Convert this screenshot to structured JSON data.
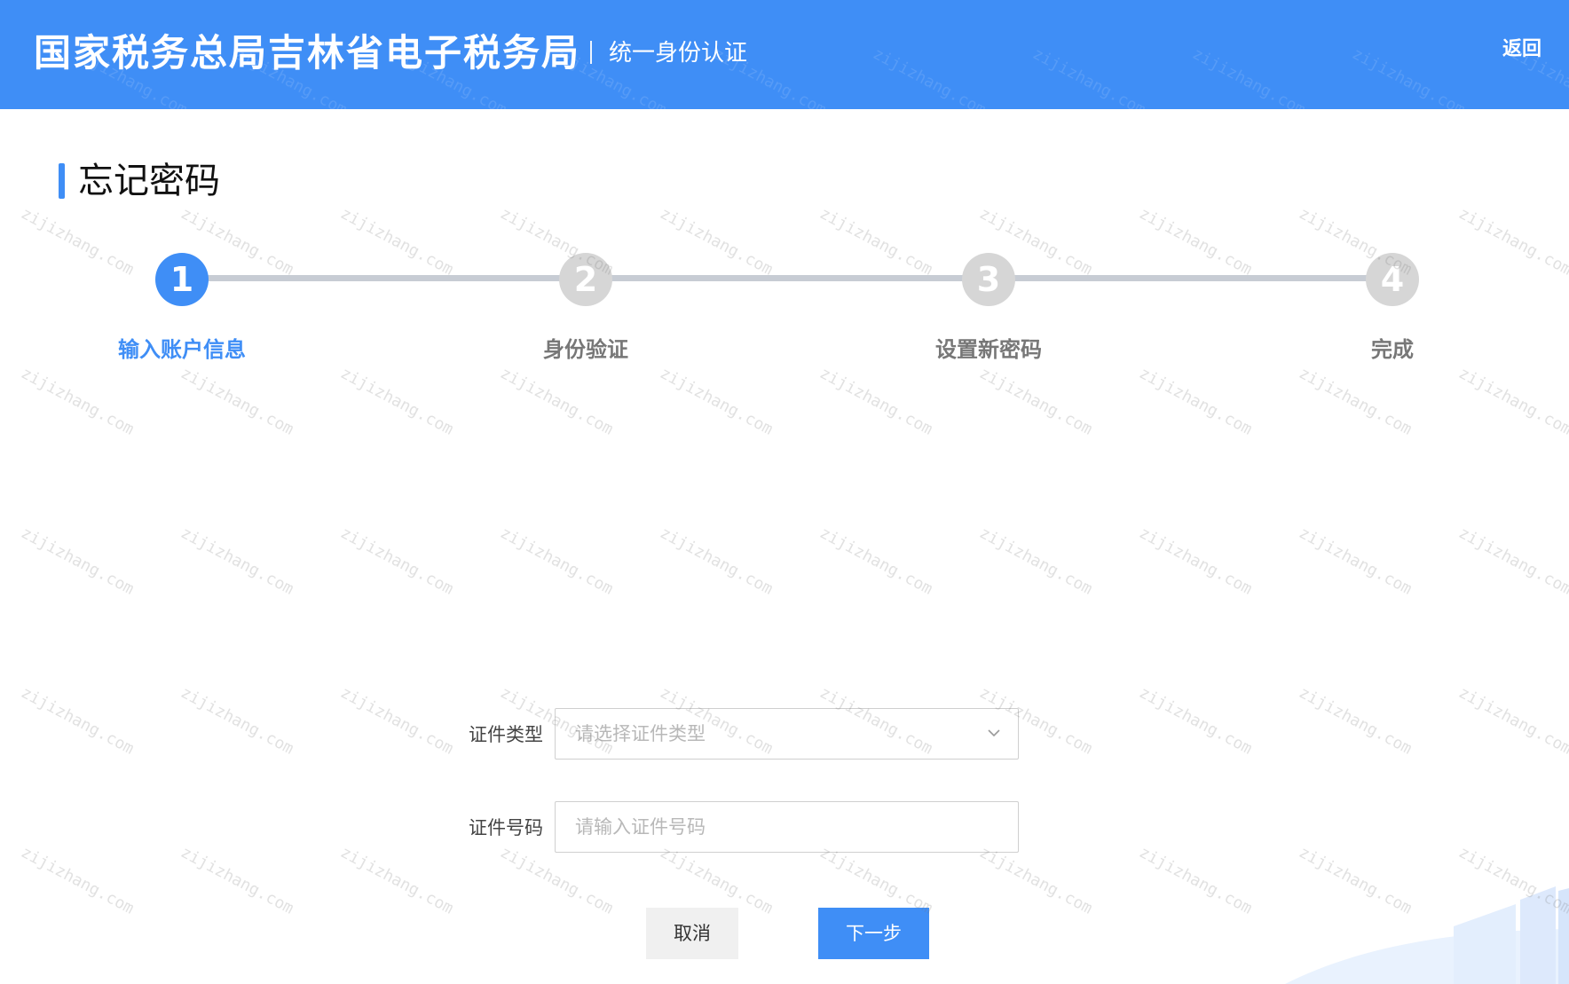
{
  "header": {
    "brand": "国家税务总局吉林省电子税务局",
    "subtitle": "统一身份认证",
    "back_label": "返回"
  },
  "page": {
    "title": "忘记密码"
  },
  "steps": [
    {
      "number": "1",
      "label": "输入账户信息",
      "active": true
    },
    {
      "number": "2",
      "label": "身份验证",
      "active": false
    },
    {
      "number": "3",
      "label": "设置新密码",
      "active": false
    },
    {
      "number": "4",
      "label": "完成",
      "active": false
    }
  ],
  "form": {
    "id_type": {
      "label": "证件类型",
      "placeholder": "请选择证件类型",
      "icon": "chevron-down-icon"
    },
    "id_number": {
      "label": "证件号码",
      "placeholder": "请输入证件号码"
    }
  },
  "buttons": {
    "cancel": "取消",
    "next": "下一步"
  },
  "watermark": {
    "text": "zijizhang.com"
  },
  "colors": {
    "primary": "#3f8ef6",
    "step_inactive": "#d6d6d6",
    "step_line": "#c7ccd4"
  }
}
